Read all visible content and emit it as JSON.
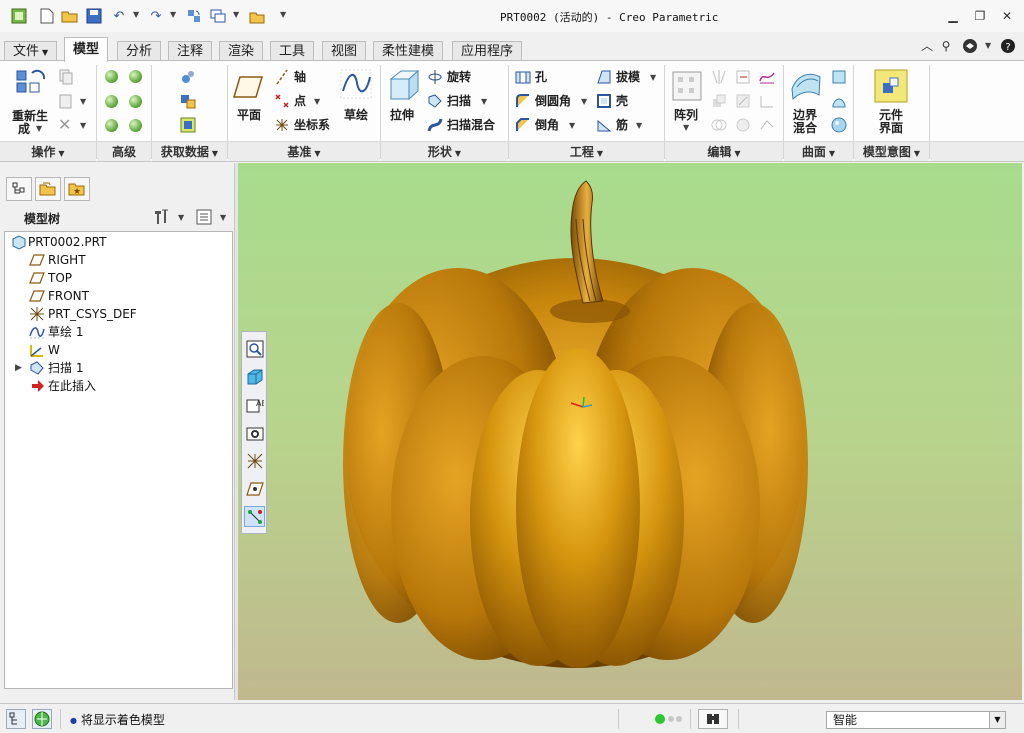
{
  "app": {
    "window_title": "PRT0002 (活动的) - Creo Parametric",
    "quick_access_icons": [
      "app-icon",
      "new-icon",
      "open-icon",
      "save-icon",
      "undo-icon",
      "redo-icon",
      "regenerate-icon",
      "windows-icon",
      "close-window-icon",
      "customize-icon"
    ],
    "window_controls": [
      "minimize",
      "restore",
      "close"
    ]
  },
  "tabs": [
    {
      "label": "文件",
      "dropdown": true
    },
    {
      "label": "模型",
      "active": true
    },
    {
      "label": "分析"
    },
    {
      "label": "注释"
    },
    {
      "label": "渲染"
    },
    {
      "label": "工具"
    },
    {
      "label": "视图"
    },
    {
      "label": "柔性建模"
    },
    {
      "label": "应用程序"
    }
  ],
  "ribbon": {
    "operations": {
      "label": "操作",
      "regen_line1": "重新生",
      "regen_line2": "成"
    },
    "advanced": {
      "label": "高级"
    },
    "get_data": {
      "label": "获取数据"
    },
    "datum": {
      "label": "基准",
      "plane": "平面",
      "axis": "轴",
      "point": "点",
      "csys": "坐标系",
      "sketch": "草绘"
    },
    "shapes": {
      "label": "形状",
      "extrude": "拉伸",
      "revolve": "旋转",
      "sweep": "扫描",
      "swept_blend": "扫描混合"
    },
    "engineering": {
      "label": "工程",
      "hole": "孔",
      "round": "倒圆角",
      "chamfer": "倒角",
      "draft": "拔模",
      "shell": "壳",
      "rib": "筋"
    },
    "editing": {
      "label": "编辑",
      "pattern": "阵列"
    },
    "surfaces": {
      "label": "曲面",
      "boundary_line1": "边界",
      "boundary_line2": "混合"
    },
    "model_intent": {
      "label": "模型意图",
      "component_line1": "元件",
      "component_line2": "界面"
    }
  },
  "model_tree": {
    "header": "模型树",
    "items": [
      {
        "label": "PRT0002.PRT",
        "icon": "part-icon",
        "indent": 0
      },
      {
        "label": "RIGHT",
        "icon": "datum-plane-icon",
        "indent": 1
      },
      {
        "label": "TOP",
        "icon": "datum-plane-icon",
        "indent": 1
      },
      {
        "label": "FRONT",
        "icon": "datum-plane-icon",
        "indent": 1
      },
      {
        "label": "PRT_CSYS_DEF",
        "icon": "csys-icon",
        "indent": 1
      },
      {
        "label": "草绘 1",
        "icon": "sketch-icon",
        "indent": 1
      },
      {
        "label": "W",
        "icon": "warp-icon",
        "indent": 1
      },
      {
        "label": "扫描 1",
        "icon": "sweep-icon",
        "indent": 1,
        "expandable": true
      },
      {
        "label": "在此插入",
        "icon": "insert-arrow-icon",
        "indent": 1
      }
    ]
  },
  "status": {
    "message": "将显示着色模型",
    "selection_filter": "智能"
  },
  "colors": {
    "pumpkin": "#c8870c",
    "pumpkin_dark": "#6a3e00",
    "bg_top": "#a8dc8c",
    "bg_bottom": "#c0b88e"
  }
}
